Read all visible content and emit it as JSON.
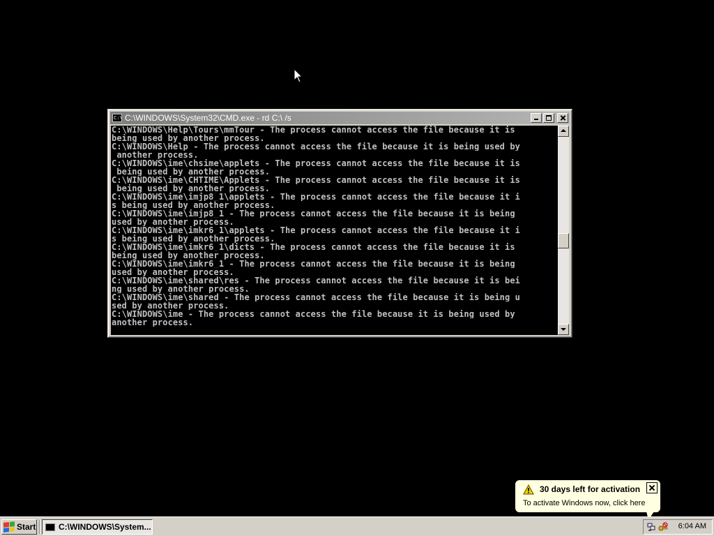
{
  "console_window": {
    "title": "C:\\WINDOWS\\System32\\CMD.exe - rd C:\\ /s",
    "icon": "console-app-icon",
    "lines": [
      "C:\\WINDOWS\\Help\\Tours\\mmTour - The process cannot access the file because it is",
      "being used by another process.",
      "C:\\WINDOWS\\Help - The process cannot access the file because it is being used by",
      " another process.",
      "C:\\WINDOWS\\ime\\chsime\\applets - The process cannot access the file because it is",
      " being used by another process.",
      "C:\\WINDOWS\\ime\\CHTIME\\Applets - The process cannot access the file because it is",
      " being used by another process.",
      "C:\\WINDOWS\\ime\\imjp8_1\\applets - The process cannot access the file because it i",
      "s being used by another process.",
      "C:\\WINDOWS\\ime\\imjp8_1 - The process cannot access the file because it is being",
      "used by another process.",
      "C:\\WINDOWS\\ime\\imkr6_1\\applets - The process cannot access the file because it i",
      "s being used by another process.",
      "C:\\WINDOWS\\ime\\imkr6_1\\dicts - The process cannot access the file because it is",
      "being used by another process.",
      "C:\\WINDOWS\\ime\\imkr6_1 - The process cannot access the file because it is being",
      "used by another process.",
      "C:\\WINDOWS\\ime\\shared\\res - The process cannot access the file because it is bei",
      "ng used by another process.",
      "C:\\WINDOWS\\ime\\shared - The process cannot access the file because it is being u",
      "sed by another process.",
      "C:\\WINDOWS\\ime - The process cannot access the file because it is being used by",
      "another process.",
      ""
    ]
  },
  "balloon": {
    "title": "30 days left for activation",
    "body": "To activate Windows now, click here",
    "icon": "warning-icon"
  },
  "taskbar": {
    "start_label": "Start",
    "task_label": "C:\\WINDOWS\\System...",
    "clock": "6:04 AM",
    "tray_icons": [
      "network-icon",
      "activation-key-icon"
    ]
  },
  "colors": {
    "desktop": "#000000",
    "console_bg": "#000000",
    "console_text": "#c0c0c0",
    "chrome": "#d4d0c8",
    "balloon_bg": "#ffffe1"
  }
}
